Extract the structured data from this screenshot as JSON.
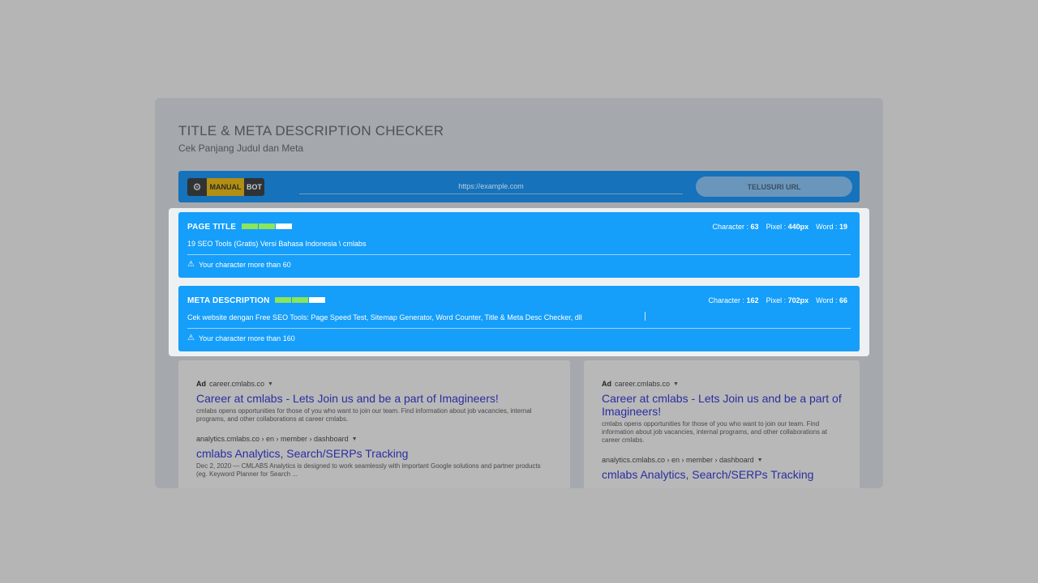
{
  "app": {
    "title": "TITLE & META DESCRIPTION CHECKER",
    "subtitle": "Cek Panjang Judul dan Meta"
  },
  "toolbar": {
    "gear_icon": "gear-icon",
    "manual_label": "MANUAL",
    "bot_label": "BOT",
    "url_placeholder": "https://example.com",
    "url_value": "",
    "search_label": "TELUSURI URL",
    "active_mode": "MANUAL"
  },
  "page_title": {
    "label": "PAGE TITLE",
    "meter_filled_segments": 2,
    "meter_total_segments": 3,
    "character_label": "Character :",
    "character_value": "63",
    "pixel_label": "Pixel :",
    "pixel_value": "440px",
    "word_label": "Word :",
    "word_value": "19",
    "text": "19 SEO Tools (Gratis) Versi Bahasa Indonesia \\ cmlabs",
    "warning": "Your character more than 60"
  },
  "meta_description": {
    "label": "META DESCRIPTION",
    "meter_filled_segments": 2,
    "meter_total_segments": 3,
    "character_label": "Character :",
    "character_value": "162",
    "pixel_label": "Pixel :",
    "pixel_value": "702px",
    "word_label": "Word :",
    "word_value": "66",
    "text": "Cek website dengan Free SEO Tools: Page Speed Test, Sitemap Generator, Word Counter, Title & Meta Desc Checker, dll",
    "warning": "Your character more than 160"
  },
  "serp_left": {
    "ad_badge": "Ad",
    "ad_domain": "career.cmlabs.co",
    "ad_title": "Career at cmlabs - Lets Join us and be a part of Imagineers!",
    "ad_desc": "cmlabs opens opportunities for those of you who want to join our team. Find information about job vacancies, internal programs, and other collaborations at career cmlabs.",
    "result_crumb": "analytics.cmlabs.co › en › member › dashboard",
    "result_title": "cmlabs Analytics, Search/SERPs Tracking",
    "result_desc": "Dec 2, 2020 — CMLABS Analytics is designed to work seamlessly with important Google solutions and partner products (eg. Keyword Planner for Search ..."
  },
  "serp_right": {
    "ad_badge": "Ad",
    "ad_domain": "career.cmlabs.co",
    "ad_title": "Career at cmlabs - Lets Join us and be a part of Imagineers!",
    "ad_desc": "cmlabs opens opportunities for those of you who want to join our team. Find information about job vacancies, internal programs, and other collaborations at career cmlabs.",
    "result_crumb": "analytics.cmlabs.co › en › member › dashboard",
    "result_title": "cmlabs Analytics, Search/SERPs Tracking"
  },
  "colors": {
    "panel_blue": "#159efa",
    "toolbar_blue": "#1672ba",
    "meter_good": "#8ce55a",
    "manual_active": "#b28f12",
    "link_blue": "#2a2ea0"
  }
}
